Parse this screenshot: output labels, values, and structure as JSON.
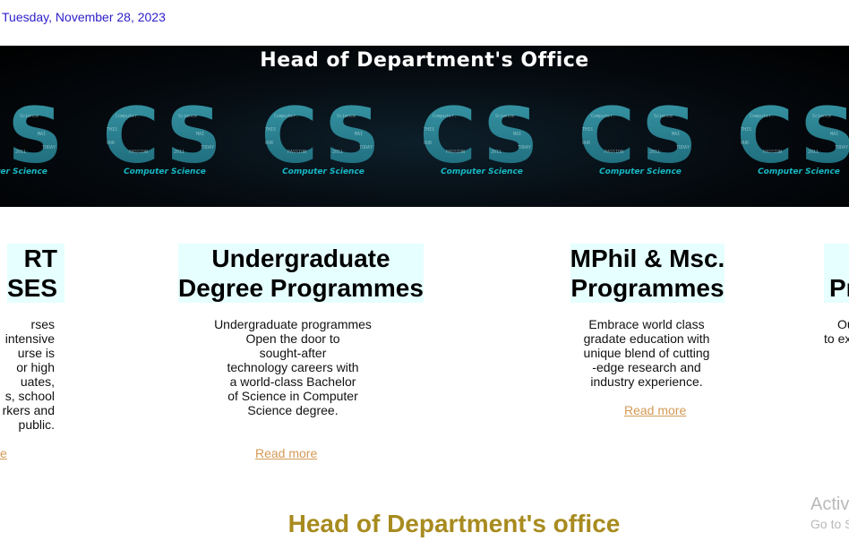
{
  "date": "Tuesday, November 28, 2023",
  "banner": {
    "title": "Head of Department's Office",
    "logo_text": "CS",
    "caption": "Computer Science",
    "tile_count": 6
  },
  "cards": [
    {
      "title_lines": [
        "RT",
        "SES"
      ],
      "text_lines": [
        "rses",
        "intensive",
        "urse is",
        "or high",
        "uates,",
        "s, school",
        "rkers and",
        "public."
      ],
      "link": "e"
    },
    {
      "title_lines": [
        "Undergraduate",
        "Degree Programmes"
      ],
      "text_lines": [
        "Undergraduate programmes",
        "Open the door to",
        "sought-after",
        "technology careers with",
        "a world-class Bachelor",
        "of Science in Computer",
        "Science degree."
      ],
      "link": "Read more"
    },
    {
      "title_lines": [
        "MPhil & Msc.",
        "Programmes"
      ],
      "text_lines": [
        "Embrace world class",
        "gradate education with",
        "unique blend of cutting",
        "-edge research and",
        "industry experience."
      ],
      "link": "Read more"
    },
    {
      "title_lines": [
        "",
        "Pr"
      ],
      "text_lines": [
        "Ou",
        "to ex"
      ]
    }
  ],
  "section_heading": "Head of Department's office",
  "activation": {
    "line1": "Activ",
    "line2": "Go to S"
  },
  "colors": {
    "date": "#2e20c8",
    "card_title_bg": "#e6ffff",
    "link": "#d39a55",
    "section_heading": "#a88b1f",
    "caption": "#16b8c4"
  }
}
